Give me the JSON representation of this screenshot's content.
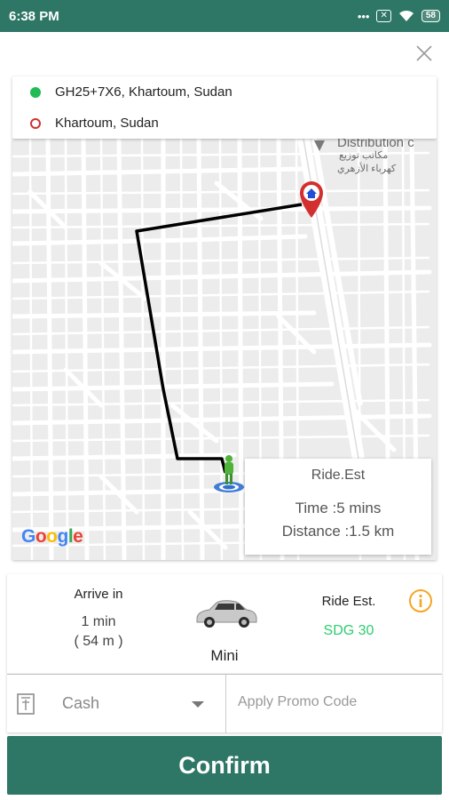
{
  "status_bar": {
    "time": "6:38 PM",
    "battery": "58"
  },
  "addresses": {
    "pickup": "GH25+7X6, Khartoum, Sudan",
    "dropoff": "Khartoum, Sudan"
  },
  "map": {
    "poi_label_en": "Distribution c",
    "poi_label_ar_1": "مكاتب توزيع",
    "poi_label_ar_2": "كهرباء الأزهري",
    "attribution": "Google",
    "estimate": {
      "title": "Ride.Est",
      "time": "Time :5 mins",
      "distance": "Distance :1.5 km"
    }
  },
  "ride": {
    "arrive_label": "Arrive in",
    "arrive_time": "1 min",
    "arrive_distance": "( 54 m )",
    "vehicle_name": "Mini",
    "est_label": "Ride Est.",
    "est_price": "SDG 30"
  },
  "payment": {
    "method": "Cash",
    "promo_placeholder": "Apply Promo Code"
  },
  "confirm_label": "Confirm",
  "colors": {
    "primary": "#2e7766",
    "price_green": "#2ecc71",
    "pickup_dot": "#22bb55",
    "dropoff_ring": "#d32f2f",
    "info_icon": "#f5a623"
  }
}
